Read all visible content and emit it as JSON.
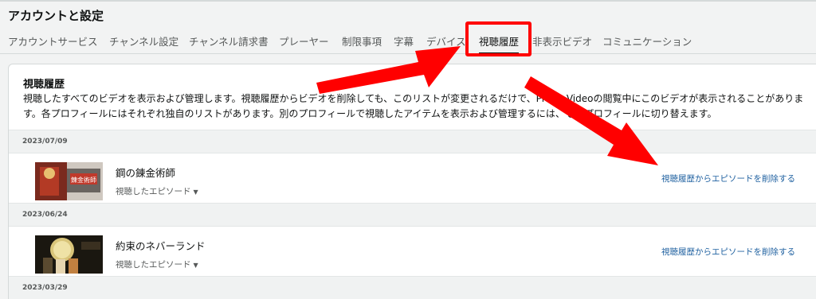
{
  "page": {
    "title": "アカウントと設定"
  },
  "tabs": [
    {
      "label": "アカウントサービス",
      "active": false
    },
    {
      "label": "チャンネル設定",
      "active": false
    },
    {
      "label": "チャンネル請求書",
      "active": false
    },
    {
      "label": "プレーヤー",
      "active": false
    },
    {
      "label": "制限事項",
      "active": false
    },
    {
      "label": "字幕",
      "active": false
    },
    {
      "label": "デバイス",
      "active": false
    },
    {
      "label": "視聴履歴",
      "active": true
    },
    {
      "label": "非表示ビデオ",
      "active": false
    },
    {
      "label": "コミュニケーション",
      "active": false
    }
  ],
  "history": {
    "title": "視聴履歴",
    "description": "視聴したすべてのビデオを表示および管理します。視聴履歴からビデオを削除しても、このリストが変更されるだけで、Prime Videoの閲覧中にこのビデオが表示されることがあります。各プロフィールにはそれぞれ独自のリストがあります。別のプロフィールで視聴したアイテムを表示および管理するには、そのプロフィールに切り替えます。",
    "groups": [
      {
        "date": "2023/07/09",
        "item": {
          "title": "鋼の錬金術師",
          "sub": "視聴したエピソード",
          "action": "視聴履歴からエピソードを削除する"
        }
      },
      {
        "date": "2023/06/24",
        "item": {
          "title": "約束のネバーランド",
          "sub": "視聴したエピソード",
          "action": "視聴履歴からエピソードを削除する"
        }
      },
      {
        "date": "2023/03/29"
      }
    ]
  },
  "annotation": {
    "color": "#ff0000"
  }
}
